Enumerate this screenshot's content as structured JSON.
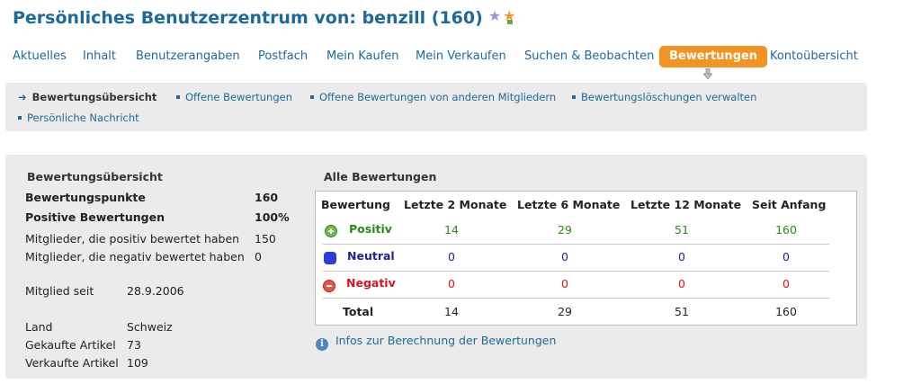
{
  "page": {
    "title": "Persönliches Benutzerzentrum von: benzill (160)"
  },
  "tabs": [
    {
      "label": "Aktuelles"
    },
    {
      "label": "Inhalt"
    },
    {
      "label": "Benutzerangaben"
    },
    {
      "label": "Postfach"
    },
    {
      "label": "Mein Kaufen"
    },
    {
      "label": "Mein Verkaufen"
    },
    {
      "label": "Suchen & Beobachten"
    },
    {
      "label": "Bewertungen",
      "active": true
    },
    {
      "label": "Kontoübersicht"
    }
  ],
  "subnav": {
    "current": "Bewertungsübersicht",
    "items": [
      "Offene Bewertungen",
      "Offene Bewertungen von anderen Mitgliedern",
      "Bewertungslöschungen verwalten",
      "Persönliche Nachricht"
    ]
  },
  "summary": {
    "title": "Bewertungsübersicht",
    "rows": [
      {
        "label": "Bewertungspunkte",
        "value": "160"
      },
      {
        "label": "Positive Bewertungen",
        "value": "100%"
      },
      {
        "label": "Mitglieder, die positiv bewertet haben",
        "value": "150"
      },
      {
        "label": "Mitglieder, die negativ bewertet haben",
        "value": "0"
      }
    ],
    "member_since": {
      "label": "Mitglied seit",
      "value": "28.9.2006"
    },
    "details": [
      {
        "label": "Land",
        "value": "Schweiz"
      },
      {
        "label": "Gekaufte Artikel",
        "value": "73"
      },
      {
        "label": "Verkaufte Artikel",
        "value": "109"
      }
    ]
  },
  "ratings": {
    "title": "Alle Bewertungen",
    "columns": [
      "Bewertung",
      "Letzte 2 Monate",
      "Letzte 6 Monate",
      "Letzte 12 Monate",
      "Seit Anfang"
    ],
    "rows": [
      {
        "label": "Positiv",
        "icon": "plus-circle-icon",
        "color": "#2b8a17",
        "values": [
          "14",
          "29",
          "51",
          "160"
        ]
      },
      {
        "label": "Neutral",
        "icon": "neutral-dot-icon",
        "color": "#23238f",
        "values": [
          "0",
          "0",
          "0",
          "0"
        ]
      },
      {
        "label": "Negativ",
        "icon": "minus-circle-icon",
        "color": "#d4161d",
        "values": [
          "0",
          "0",
          "0",
          "0"
        ]
      },
      {
        "label": "Total",
        "values": [
          "14",
          "29",
          "51",
          "160"
        ]
      }
    ]
  },
  "info_link": "Infos zur Berechnung der Bewertungen",
  "colors": {
    "brand_blue": "#1c6a9c",
    "active_tab": "#f39321",
    "panel_bg": "#ebebeb"
  }
}
